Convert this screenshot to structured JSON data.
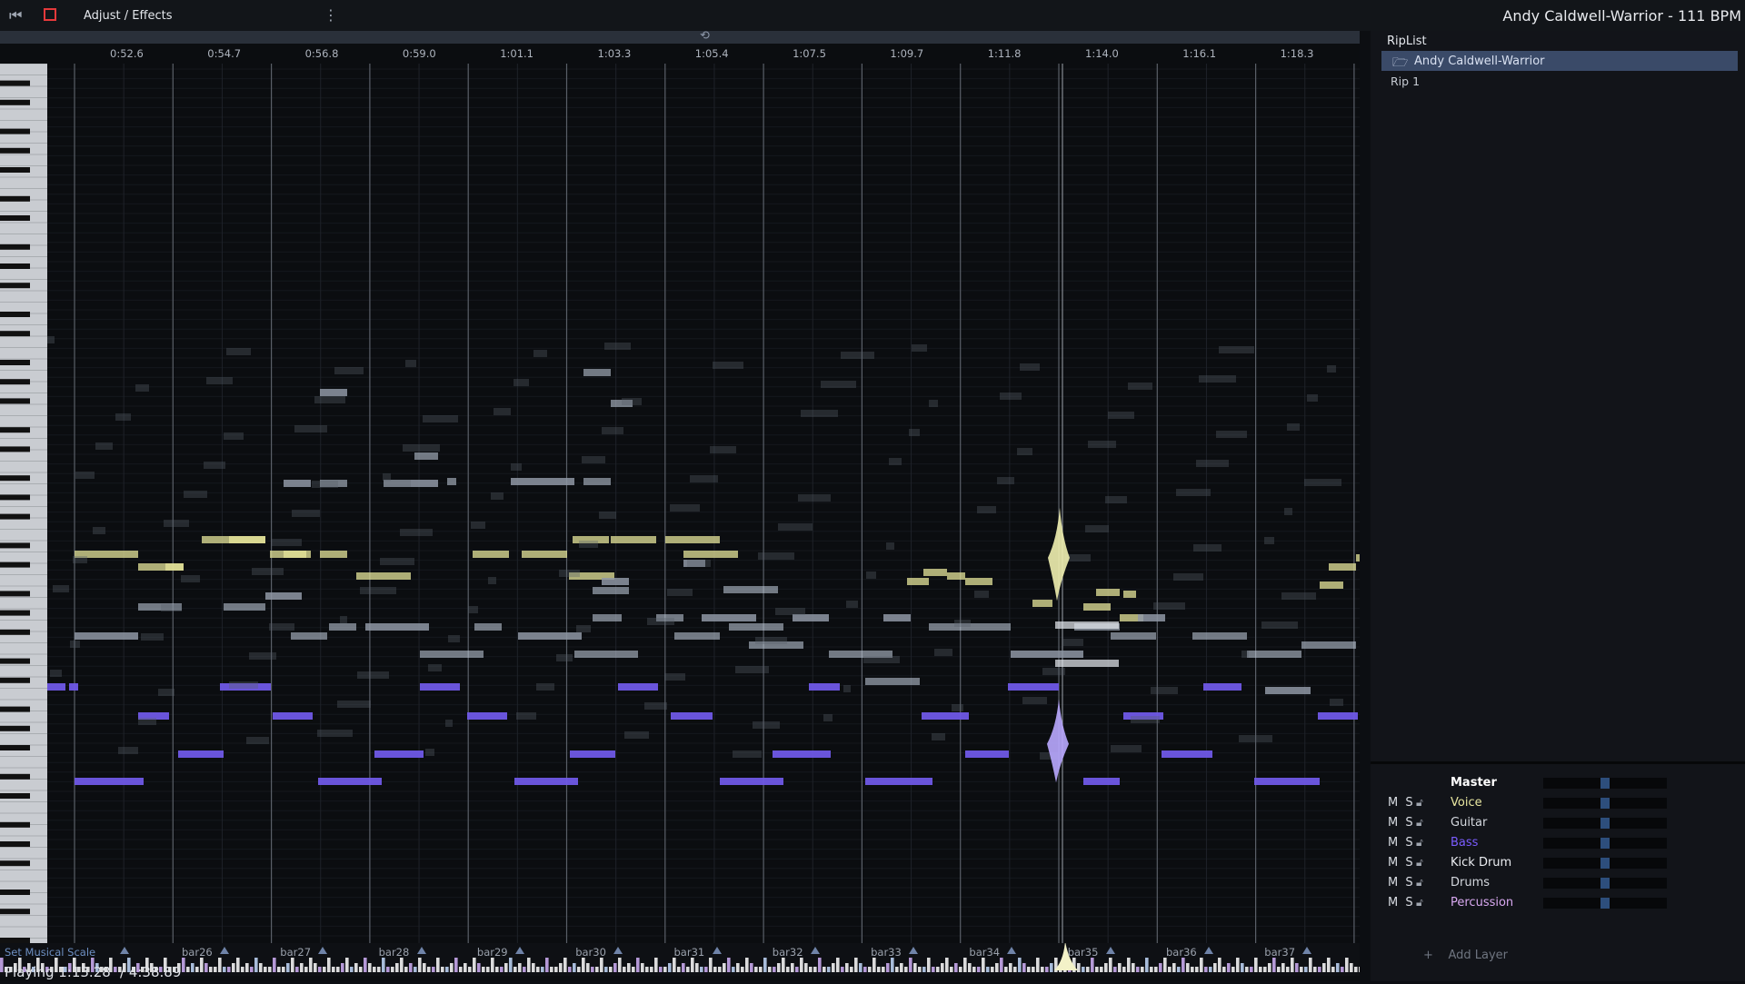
{
  "topbar": {
    "menu_title": "Adjust / Effects",
    "more_glyph": "⋮",
    "song_title": "Andy Caldwell-Warrior - 111 BPM"
  },
  "icons": {
    "back": "skip-back-icon",
    "stop": "stop-icon",
    "loop": "loop-icon",
    "folder": "folder-icon",
    "lock": "unlock-icon",
    "add": "plus-icon"
  },
  "timeline": {
    "time_labels": [
      "0:52.6",
      "0:54.7",
      "0:56.8",
      "0:59.0",
      "1:01.1",
      "1:03.3",
      "1:05.4",
      "1:07.5",
      "1:09.7",
      "1:11.8",
      "1:14.0",
      "1:16.1",
      "1:18.3"
    ],
    "bar_labels": [
      "bar26",
      "bar27",
      "bar28",
      "bar29",
      "bar30",
      "bar31",
      "bar32",
      "bar33",
      "bar34",
      "bar35",
      "bar36",
      "bar37"
    ],
    "scale_button": "Set Musical Scale"
  },
  "status": {
    "playing": "Playing 1:13.28",
    "total": "/ 4:38.89"
  },
  "riplist": {
    "title": "RipList",
    "song": "Andy Caldwell-Warrior",
    "items": [
      "Rip 1"
    ]
  },
  "mixer": {
    "master": "Master",
    "ms_label": "M S",
    "layers": [
      {
        "name": "Voice",
        "color": "#e8e6a0"
      },
      {
        "name": "Guitar",
        "color": "#d4d8de"
      },
      {
        "name": "Bass",
        "color": "#7b5cff"
      },
      {
        "name": "Kick Drum",
        "color": "#eceef2"
      },
      {
        "name": "Drums",
        "color": "#d4d8de"
      },
      {
        "name": "Percussion",
        "color": "#d8a8f0"
      }
    ],
    "add_layer": "Add Layer"
  },
  "colors": {
    "voice": "#e6e49a",
    "guitar": "#c9d3e2",
    "bass": "#6f58e6",
    "accent": "#3a4a68",
    "stop": "#e5393b"
  }
}
